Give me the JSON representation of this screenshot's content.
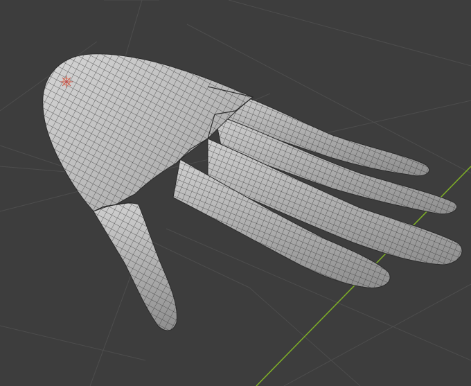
{
  "viewport": {
    "background": "#3d3d3d",
    "grid_color": "#4c4c4c",
    "axis_y_color": "#7fb026",
    "mesh_fill": "#b8b8b8",
    "mesh_wire": "#2b2b2b",
    "origin_marker": "light-origin-icon"
  }
}
